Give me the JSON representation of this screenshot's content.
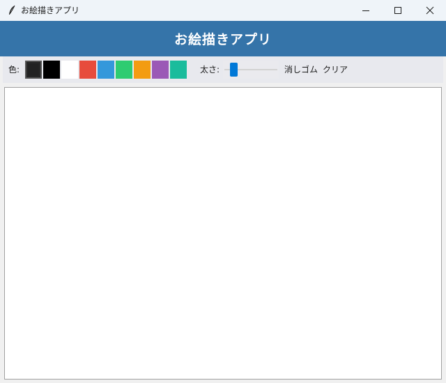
{
  "window": {
    "title": "お絵描きアプリ"
  },
  "icons": {
    "app": "feather-icon",
    "minimize": "minimize-icon",
    "maximize": "maximize-icon",
    "close": "close-icon"
  },
  "header": {
    "title": "お絵描きアプリ",
    "background": "#3574a9"
  },
  "toolbar": {
    "color_label": "色:",
    "colors": [
      "#222222",
      "#000000",
      "#ffffff",
      "#e74c3c",
      "#3498db",
      "#2ecc71",
      "#f39c12",
      "#9b59b6",
      "#1abc9c"
    ],
    "selected_color_index": 0,
    "size_label": "太さ:",
    "size_slider_fraction": 0.15,
    "eraser_label": "消しゴム",
    "clear_label": "クリア"
  }
}
